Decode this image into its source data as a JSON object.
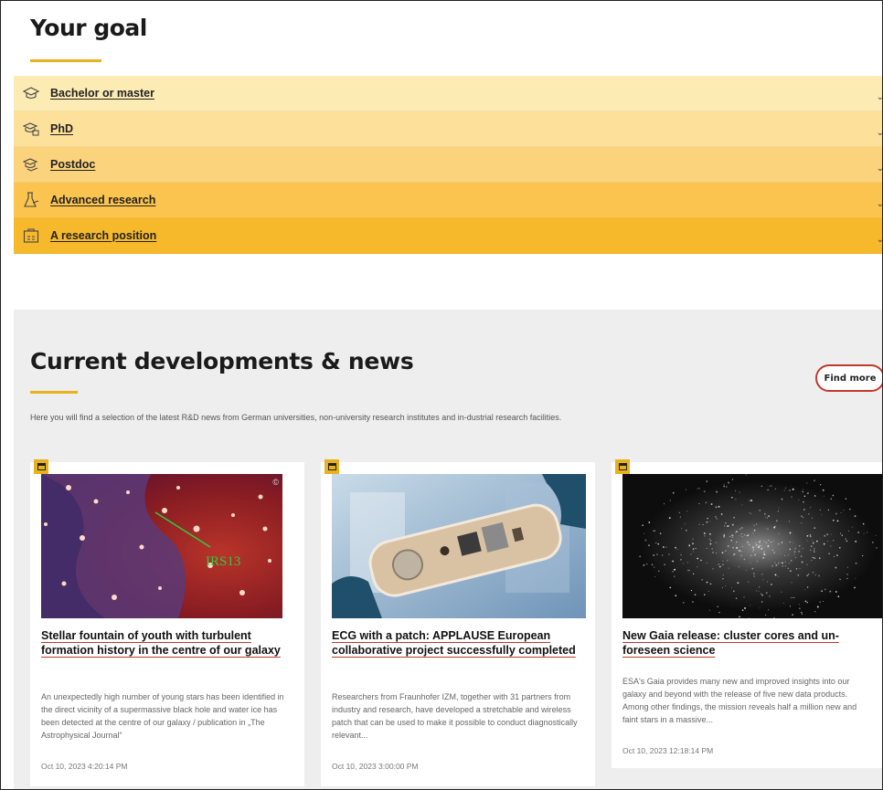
{
  "goal": {
    "title": "Your goal",
    "items": [
      {
        "label": "Bachelor or master",
        "icon": "graduation-cap-icon"
      },
      {
        "label": "PhD",
        "icon": "hat-scroll-icon"
      },
      {
        "label": "Postdoc",
        "icon": "hat-stack-icon"
      },
      {
        "label": "Advanced research",
        "icon": "flask-icon"
      },
      {
        "label": "A research position",
        "icon": "calendar-board-icon"
      }
    ]
  },
  "news": {
    "title": "Current developments & news",
    "find_more": "Find more",
    "intro": "Here you will find a selection of the latest R&D news from German universities, non-university research institutes and in-dustrial research facilities.",
    "cards": [
      {
        "title": "Stellar fountain of youth with turbulent formation history in the centre of our galaxy",
        "image_label": "IRS13",
        "copyright": "©",
        "description": "An unexpectedly high number of young stars has been identified in the direct vicinity of a supermassive black hole and water ice has been detected at the centre of our galaxy / publication in „The Astrophysical Journal“",
        "date": "Oct 10, 2023 4:20:14 PM"
      },
      {
        "title": "ECG with a patch: APPLAUSE European collaborative project successfully completed",
        "description": "Researchers from Fraunhofer IZM, together with 31 partners from industry and research, have developed a stretchable and wireless patch that can be used to make it possible to conduct diagnostically relevant...",
        "date": "Oct 10, 2023 3:00:00 PM"
      },
      {
        "title": "New Gaia release: cluster cores and un-foreseen science",
        "description": "ESA's Gaia provides many new and improved insights into our galaxy and beyond with the release of five new data products. Among other findings, the mission reveals half a million new and faint stars in a massive...",
        "date": "Oct 10, 2023 12:18:14 PM"
      }
    ]
  }
}
